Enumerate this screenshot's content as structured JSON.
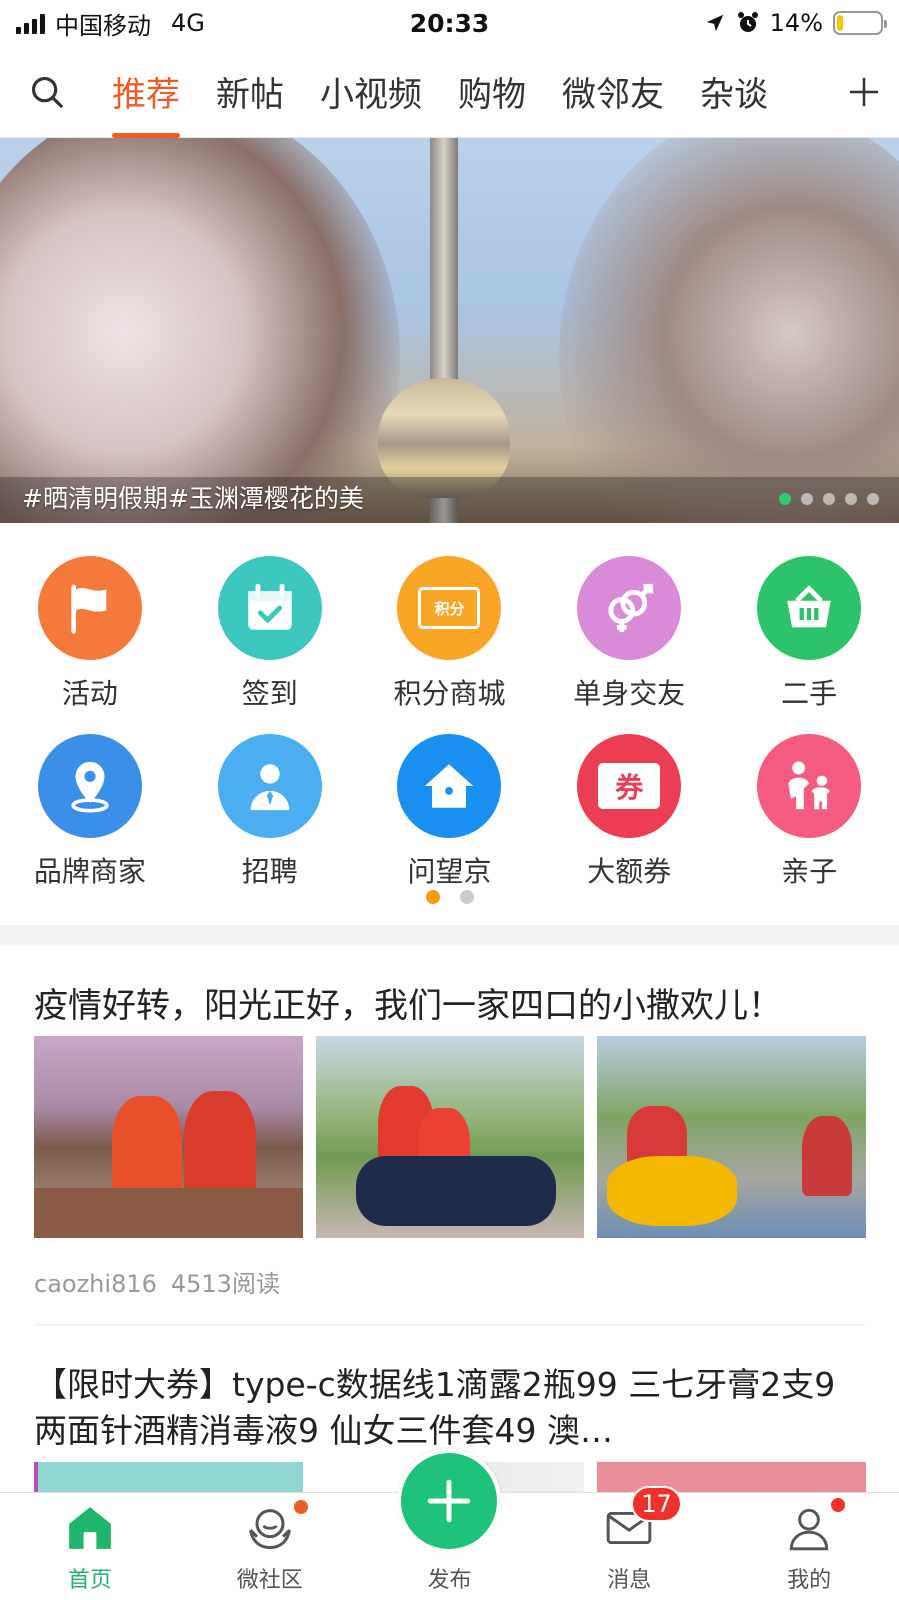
{
  "status_bar": {
    "carrier": "中国移动",
    "network": "4G",
    "time": "20:33",
    "battery": "14%",
    "battery_level": 0.14
  },
  "top_nav": {
    "tabs": [
      {
        "label": "推荐",
        "active": true
      },
      {
        "label": "新帖"
      },
      {
        "label": "小视频"
      },
      {
        "label": "购物"
      },
      {
        "label": "微邻友"
      },
      {
        "label": "杂谈"
      }
    ]
  },
  "banner": {
    "caption": "#晒清明假期#玉渊潭樱花的美",
    "slide_count": 5,
    "active_slide": 1
  },
  "grid": {
    "items": [
      {
        "label": "活动",
        "icon": "flag-icon",
        "color": "#f5793b"
      },
      {
        "label": "签到",
        "icon": "calendar-check-icon",
        "color": "#3cc6c0"
      },
      {
        "label": "积分商城",
        "icon": "points-card-icon",
        "color": "#f9a627",
        "icon_text": "积分"
      },
      {
        "label": "单身交友",
        "icon": "gender-rings-icon",
        "color": "#d98ad8"
      },
      {
        "label": "二手",
        "icon": "basket-icon",
        "color": "#2dc36b"
      },
      {
        "label": "品牌商家",
        "icon": "location-pin-icon",
        "color": "#3c8fe8"
      },
      {
        "label": "招聘",
        "icon": "person-tie-icon",
        "color": "#4aaef0"
      },
      {
        "label": "问望京",
        "icon": "house-icon",
        "color": "#1a8ff2"
      },
      {
        "label": "大额券",
        "icon": "coupon-icon",
        "color": "#ec3e52",
        "icon_text": "券"
      },
      {
        "label": "亲子",
        "icon": "parent-child-icon",
        "color": "#f55b80"
      }
    ],
    "page_count": 2,
    "active_page": 1
  },
  "feed": {
    "post1": {
      "title": "疫情好转，阳光正好，我们一家四口的小撒欢儿！",
      "author": "caozhi816",
      "reads": "4513阅读"
    },
    "post2": {
      "title": "【限时大券】type-c数据线1滴露2瓶99 三七牙膏2支9 两面针酒精消毒液9 仙女三件套49 澳…"
    }
  },
  "bottom_bar": {
    "items": [
      {
        "label": "首页",
        "icon": "home-icon",
        "active": true
      },
      {
        "label": "微社区",
        "icon": "community-icon",
        "dot": true
      },
      {
        "label": "发布",
        "icon": "plus-icon"
      },
      {
        "label": "消息",
        "icon": "mail-icon",
        "badge": "17"
      },
      {
        "label": "我的",
        "icon": "user-icon",
        "dot": true
      }
    ]
  },
  "colors": {
    "accent": "#f05a24",
    "green": "#1fc27a"
  }
}
